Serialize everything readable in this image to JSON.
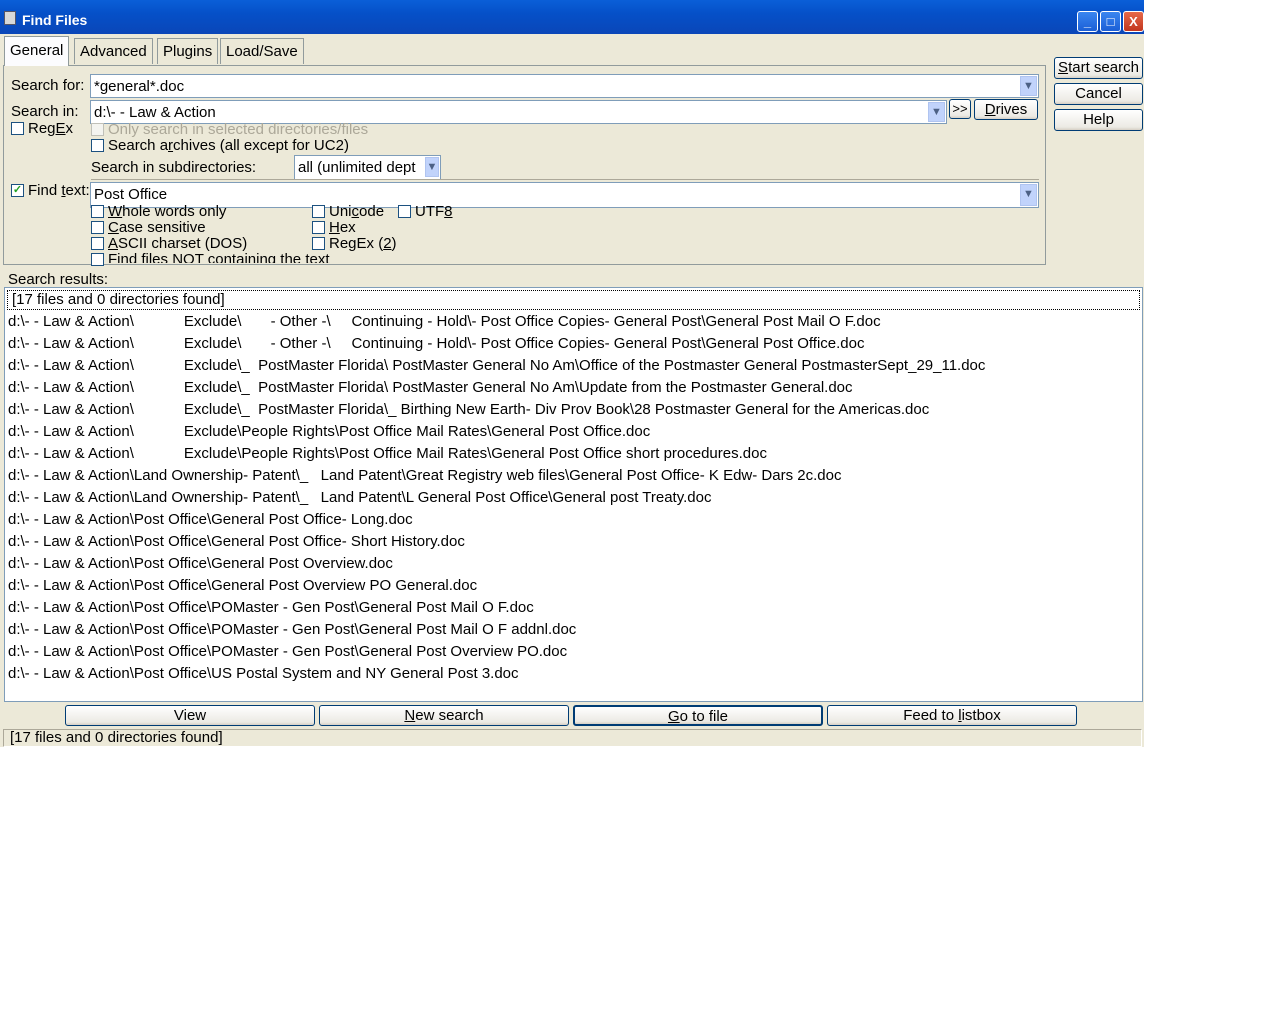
{
  "window": {
    "title": "Find Files",
    "minimize": "_",
    "maximize": "□",
    "close": "X"
  },
  "tabs": [
    {
      "label": "General"
    },
    {
      "label": "Advanced"
    },
    {
      "label": "Plugins"
    },
    {
      "label": "Load/Save"
    }
  ],
  "general": {
    "search_for_label": "Search for:",
    "search_for_value": "*general*.doc",
    "search_in_label": "Search in:",
    "search_in_value": "d:\\- - Law & Action",
    "browse_button": ">>",
    "drives_button": "Drives",
    "regex_label": "RegEx",
    "only_selected_label": "Only search in selected directories/files",
    "search_archives_label": "Search archives (all except for UC2)",
    "subdirs_label": "Search in subdirectories:",
    "subdirs_value": "all (unlimited dept",
    "find_text_label": "Find text:",
    "find_text_checked": "✓",
    "find_text_value": "Post Office",
    "whole_words_label": "Whole words only",
    "case_sensitive_label": "Case sensitive",
    "ascii_label": "ASCII charset (DOS)",
    "not_containing_label": "Find files NOT containing the text",
    "unicode_label": "Unicode",
    "utf8_label": "UTF8",
    "hex_label": "Hex",
    "regex2_label": "RegEx (2)"
  },
  "side_buttons": {
    "start": "Start search",
    "cancel": "Cancel",
    "help": "Help"
  },
  "results": {
    "label": "Search results:",
    "summary": "[17 files and 0 directories found]",
    "rows": [
      "d:\\- - Law & Action\\            Exclude\\       - Other -\\     Continuing - Hold\\- Post Office Copies- General Post\\General Post Mail O F.doc",
      "d:\\- - Law & Action\\            Exclude\\       - Other -\\     Continuing - Hold\\- Post Office Copies- General Post\\General Post Office.doc",
      "d:\\- - Law & Action\\            Exclude\\_  PostMaster Florida\\ PostMaster General No Am\\Office of the Postmaster General PostmasterSept_29_11.doc",
      "d:\\- - Law & Action\\            Exclude\\_  PostMaster Florida\\ PostMaster General No Am\\Update from the Postmaster General.doc",
      "d:\\- - Law & Action\\            Exclude\\_  PostMaster Florida\\_ Birthing New Earth- Div Prov Book\\28 Postmaster General for the Americas.doc",
      "d:\\- - Law & Action\\            Exclude\\People Rights\\Post Office Mail Rates\\General Post Office.doc",
      "d:\\- - Law & Action\\            Exclude\\People Rights\\Post Office Mail Rates\\General Post Office short procedures.doc",
      "d:\\- - Law & Action\\Land Ownership- Patent\\_   Land Patent\\Great Registry web files\\General Post Office- K Edw- Dars 2c.doc",
      "d:\\- - Law & Action\\Land Ownership- Patent\\_   Land Patent\\L General Post Office\\General post Treaty.doc",
      "d:\\- - Law & Action\\Post Office\\General Post Office- Long.doc",
      "d:\\- - Law & Action\\Post Office\\General Post Office- Short History.doc",
      "d:\\- - Law & Action\\Post Office\\General Post Overview.doc",
      "d:\\- - Law & Action\\Post Office\\General Post Overview PO General.doc",
      "d:\\- - Law & Action\\Post Office\\POMaster - Gen Post\\General Post Mail O F.doc",
      "d:\\- - Law & Action\\Post Office\\POMaster - Gen Post\\General Post Mail O F addnl.doc",
      "d:\\- - Law & Action\\Post Office\\POMaster - Gen Post\\General Post Overview PO.doc",
      "d:\\- - Law & Action\\Post Office\\US Postal System and NY General Post 3.doc"
    ]
  },
  "bottom_buttons": {
    "view": "View",
    "new_search": "New search",
    "goto_file": "Go to file",
    "feed": "Feed to listbox"
  },
  "status": "[17 files and 0 directories found]"
}
